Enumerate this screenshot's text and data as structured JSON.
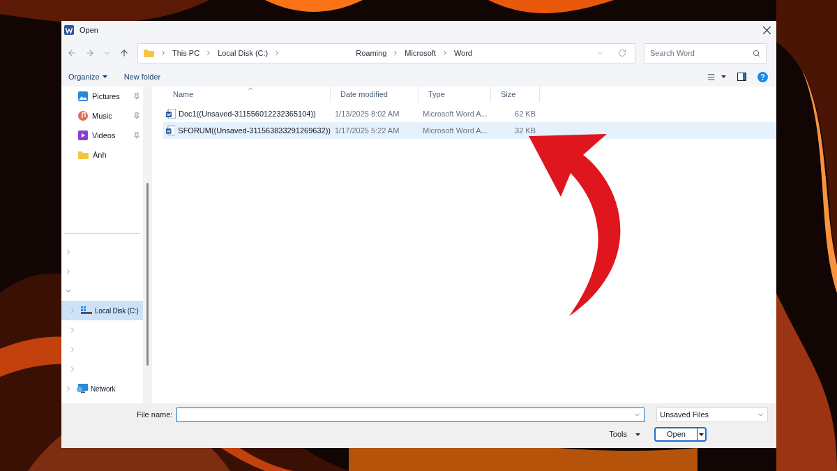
{
  "window": {
    "title": "Open"
  },
  "address_bar": {
    "crumbs": [
      "This PC",
      "Local Disk (C:)"
    ],
    "trail": [
      "Roaming",
      "Microsoft",
      "Word"
    ]
  },
  "search": {
    "placeholder": "Search Word"
  },
  "toolbar": {
    "organize": "Organize",
    "new_folder": "New folder"
  },
  "quick_access": [
    {
      "label": "Pictures",
      "kind": "pictures",
      "pinned": true
    },
    {
      "label": "Music",
      "kind": "music",
      "pinned": true
    },
    {
      "label": "Videos",
      "kind": "videos",
      "pinned": true
    },
    {
      "label": "Ảnh",
      "kind": "folder",
      "pinned": false
    }
  ],
  "tree": [
    {
      "expanded": false,
      "selected": false
    },
    {
      "expanded": false,
      "selected": false
    },
    {
      "expanded": true,
      "selected": false,
      "children": [
        {
          "label": "Local Disk (C:)",
          "kind": "disk",
          "expanded": false,
          "selected": true
        },
        {
          "expanded": false,
          "selected": false
        },
        {
          "expanded": false,
          "selected": false
        },
        {
          "expanded": false,
          "selected": false
        }
      ]
    },
    {
      "label": "Network",
      "kind": "network",
      "expanded": false,
      "selected": false
    }
  ],
  "table": {
    "columns": [
      {
        "label": "Name",
        "sorted": true
      },
      {
        "label": "Date modified",
        "sorted": false
      },
      {
        "label": "Type",
        "sorted": false
      },
      {
        "label": "Size",
        "sorted": false
      }
    ],
    "rows": [
      {
        "name": "Doc1((Unsaved-311556012232365104))",
        "date": "1/13/2025 8:02 AM",
        "type": "Microsoft Word A...",
        "size": "62 KB",
        "selected": false
      },
      {
        "name": "SFORUM((Unsaved-311563833291269632))",
        "date": "1/17/2025 5:22 AM",
        "type": "Microsoft Word A...",
        "size": "32 KB",
        "selected": true
      }
    ]
  },
  "footer": {
    "file_name_label": "File name:",
    "file_type": "Unsaved Files",
    "tools": "Tools",
    "open": "Open"
  }
}
